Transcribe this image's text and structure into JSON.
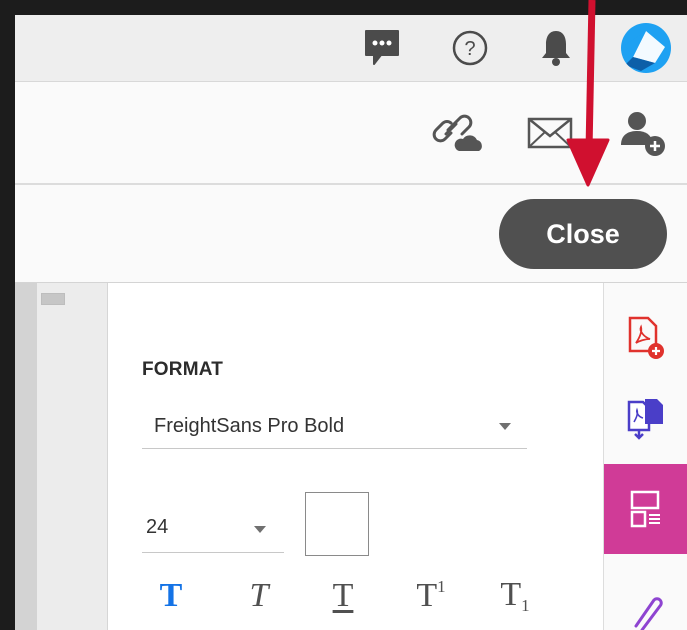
{
  "topbar": {
    "icons": [
      "chat-icon",
      "help-icon",
      "bell-icon"
    ],
    "avatar": "user-avatar"
  },
  "share": {
    "icons": [
      "link-cloud-icon",
      "email-icon",
      "add-person-icon"
    ]
  },
  "close_label": "Close",
  "format": {
    "title": "FORMAT",
    "font_value": "FreightSans Pro Bold",
    "size_value": "24",
    "swatch_color": "#ffffff",
    "styles": [
      {
        "id": "bold",
        "glyph": "T"
      },
      {
        "id": "italic",
        "glyph": "T"
      },
      {
        "id": "underline",
        "glyph": "T"
      },
      {
        "id": "superscript",
        "glyph": "T",
        "mark": "1"
      },
      {
        "id": "subscript",
        "glyph": "T",
        "mark": "1"
      }
    ],
    "active_style_color": "#1473e6"
  },
  "rightbar": {
    "tools": [
      "create-pdf-icon",
      "export-pdf-icon",
      "edit-pdf-icon",
      "comment-icon"
    ],
    "active_tool": "edit-pdf-icon",
    "active_color": "#d03b97"
  },
  "annotation": {
    "arrow_color": "#d0102f"
  }
}
